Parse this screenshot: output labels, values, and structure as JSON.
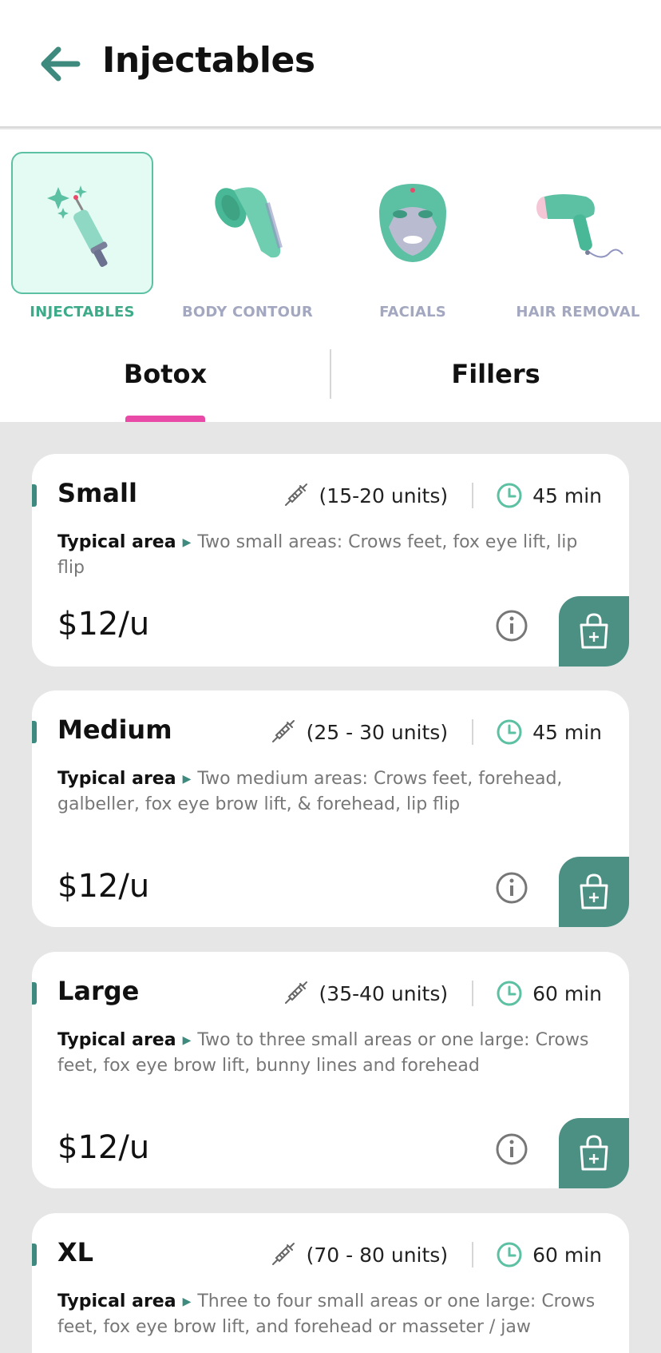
{
  "header": {
    "title": "Injectables",
    "back_icon": "arrow-left-icon"
  },
  "categories": [
    {
      "label": "INJECTABLES",
      "icon": "syringe-icon",
      "active": true
    },
    {
      "label": "BODY CONTOUR",
      "icon": "contour-roller-icon",
      "active": false
    },
    {
      "label": "FACIALS",
      "icon": "face-mask-icon",
      "active": false
    },
    {
      "label": "HAIR REMOVAL",
      "icon": "laser-device-icon",
      "active": false
    }
  ],
  "tabs": [
    {
      "label": "Botox",
      "active": true
    },
    {
      "label": "Fillers",
      "active": false
    }
  ],
  "typical_area_label": "Typical area",
  "cards": [
    {
      "size": "Small",
      "units": "(15-20 units)",
      "duration": "45 min",
      "area": "Two small areas: Crows feet, fox eye lift, lip flip",
      "price": "$12/u"
    },
    {
      "size": "Medium",
      "units": "(25 - 30 units)",
      "duration": "45 min",
      "area": "Two medium areas: Crows feet, forehead, galbeller, fox eye brow lift, & forehead, lip flip",
      "price": "$12/u"
    },
    {
      "size": "Large",
      "units": "(35-40 units)",
      "duration": "60 min",
      "area": "Two to three small areas or one large: Crows feet, fox eye brow lift, bunny lines and forehead",
      "price": "$12/u"
    },
    {
      "size": "XL",
      "units": "(70 - 80 units)",
      "duration": "60 min",
      "area": "Three to four small areas or one large: Crows feet, fox eye brow lift, and forehead or masseter / jaw",
      "price": ""
    }
  ],
  "colors": {
    "accent": "#3f8a7e",
    "teal_light": "#e4fbf4",
    "tab_indicator": "#e94aa8",
    "cart_button": "#4c8f83"
  }
}
